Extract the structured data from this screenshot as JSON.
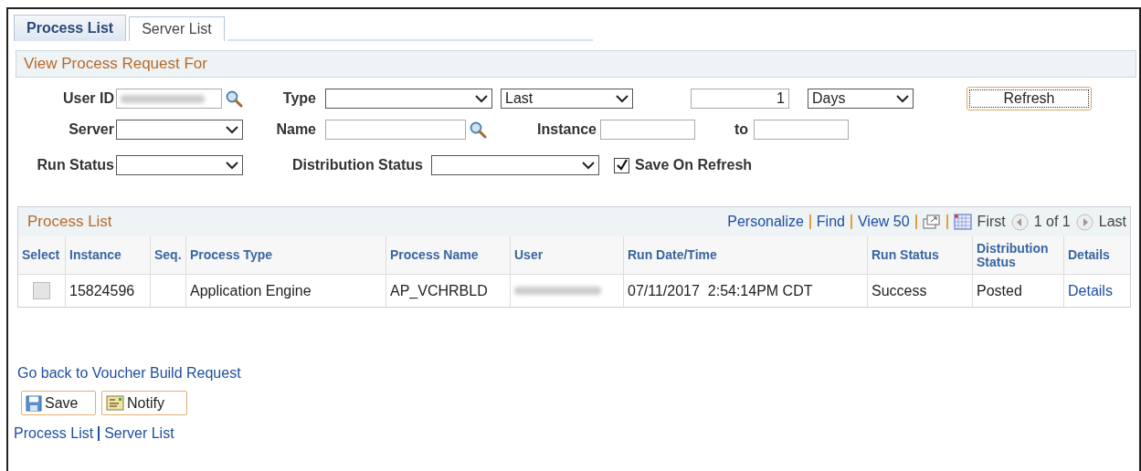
{
  "tabs": [
    {
      "label": "Process List",
      "selected": true
    },
    {
      "label": "Server List",
      "selected": false
    }
  ],
  "filter": {
    "title": "View Process Request For",
    "user_id": {
      "label": "User ID"
    },
    "type": {
      "label": "Type"
    },
    "range": {
      "value": "Last"
    },
    "count": {
      "value": "1"
    },
    "unit": {
      "value": "Days"
    },
    "refresh_button": "Refresh",
    "server": {
      "label": "Server"
    },
    "name": {
      "label": "Name"
    },
    "instance": {
      "label": "Instance"
    },
    "to": {
      "label": "to"
    },
    "run_status": {
      "label": "Run Status"
    },
    "distribution_status": {
      "label": "Distribution Status"
    },
    "save_on_refresh": {
      "label": "Save On Refresh",
      "checked": true
    }
  },
  "process_list": {
    "title": "Process List",
    "links": [
      "Personalize",
      "Find",
      "View 50"
    ],
    "pager": {
      "first": "First",
      "range": "1 of 1",
      "last": "Last"
    },
    "columns": [
      "Select",
      "Instance",
      "Seq.",
      "Process Type",
      "Process Name",
      "User",
      "Run Date/Time",
      "Run Status",
      "Distribution Status",
      "Details"
    ],
    "rows": [
      {
        "checked": false,
        "instance": "15824596",
        "process_type": "Application Engine",
        "process_name": "AP_VCHRBLD",
        "run_datetime": "07/11/2017  2:54:14PM CDT",
        "run_status": "Success",
        "distribution_status": "Posted",
        "details": "Details"
      }
    ]
  },
  "back_link": "Go back to Voucher Build Request",
  "buttons": [
    {
      "kind": "save",
      "label": "Save"
    },
    {
      "kind": "notify",
      "label": "Notify"
    }
  ],
  "footer_links": [
    "Process List",
    "Server List"
  ]
}
